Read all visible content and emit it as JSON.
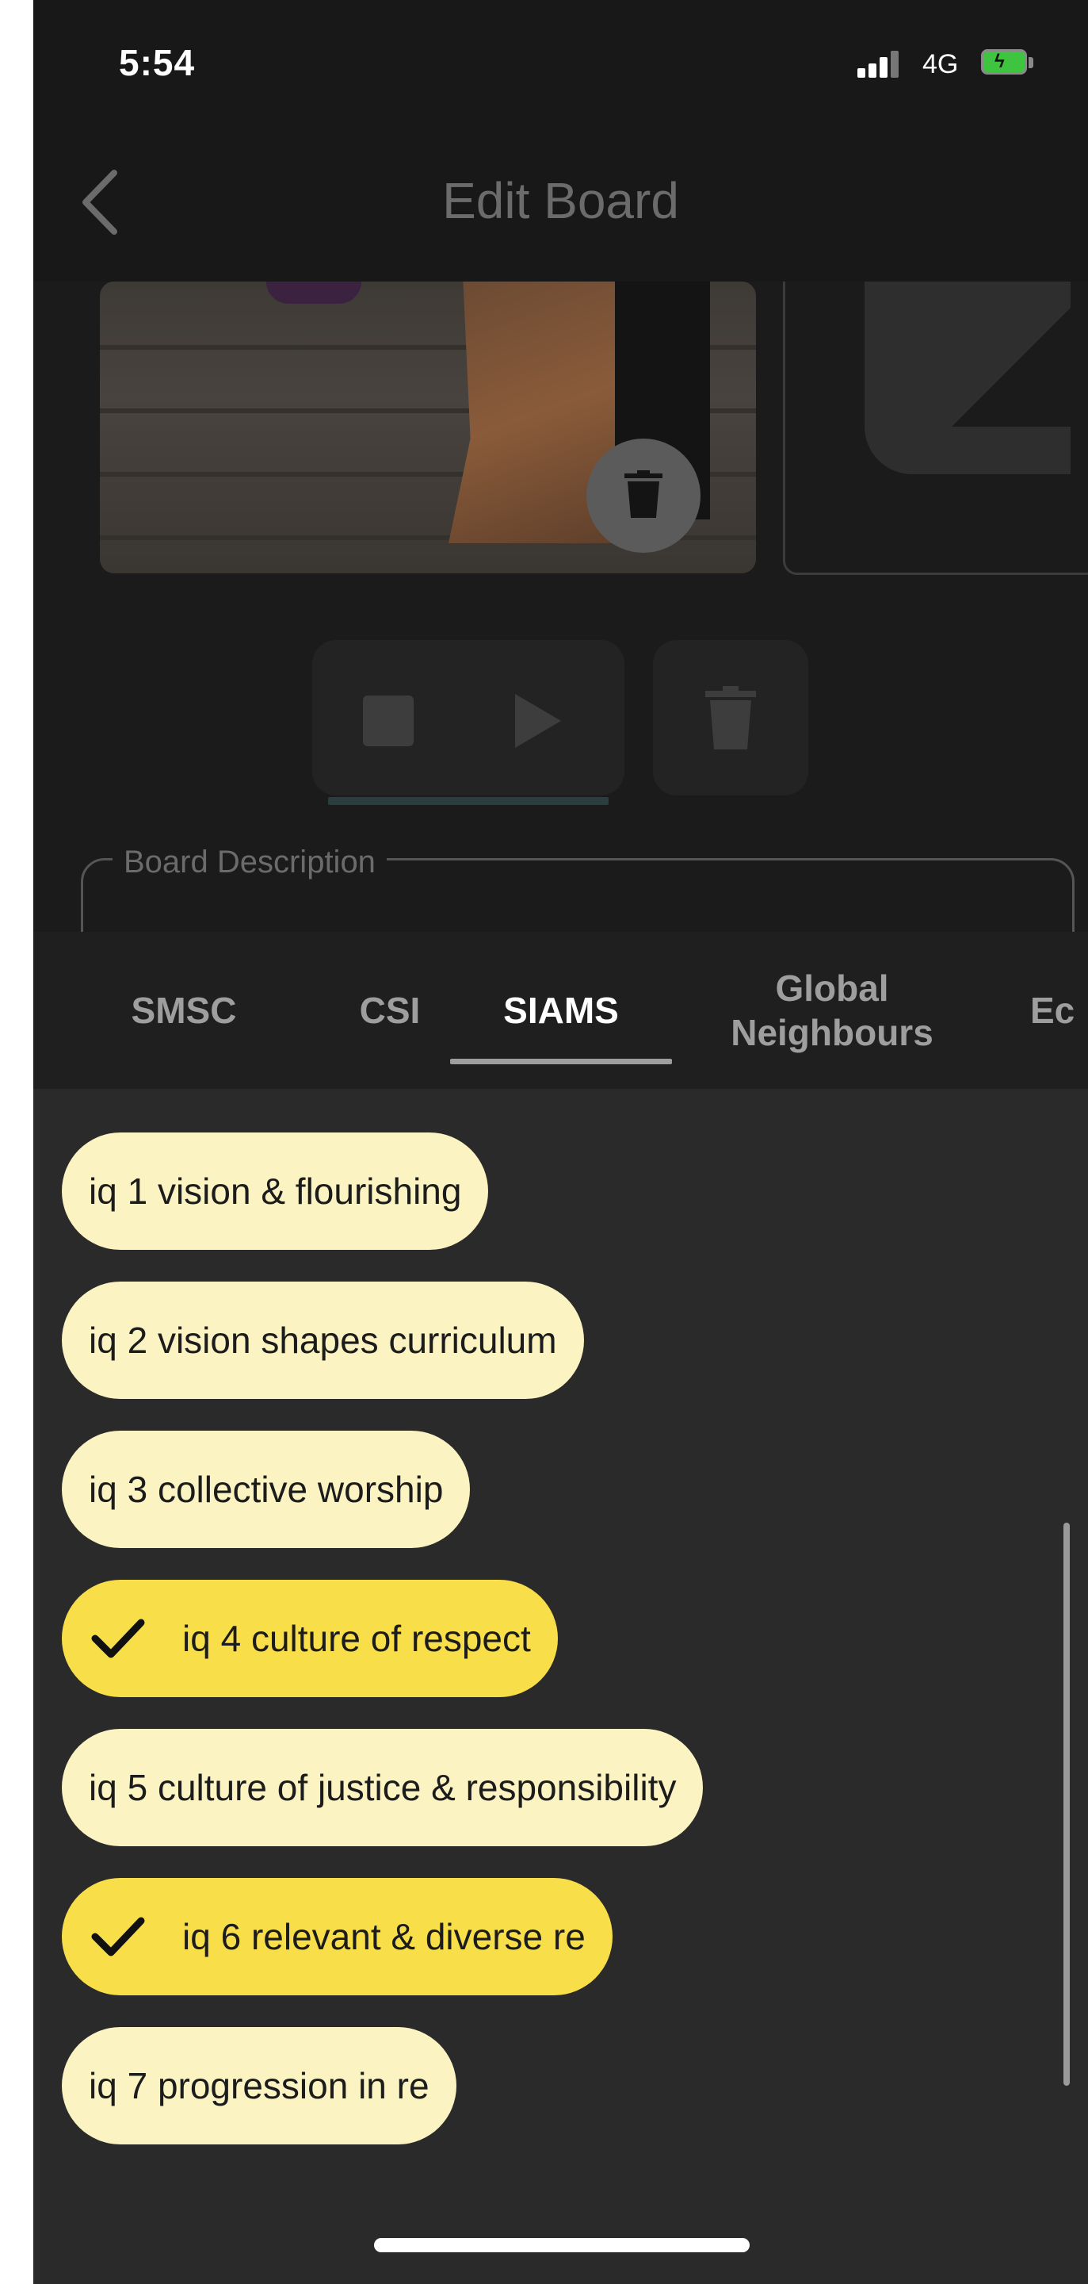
{
  "status_bar": {
    "time": "5:54",
    "network": "4G",
    "battery_color": "#3ec43e"
  },
  "nav": {
    "title": "Edit Board",
    "back_icon": "chevron-left-icon"
  },
  "description": {
    "label": "Board Description"
  },
  "tabs": [
    {
      "label": "SMSC",
      "active": false
    },
    {
      "label": "CSI",
      "active": false
    },
    {
      "label": "SIAMS",
      "active": true
    },
    {
      "label": "Global\nNeighbours",
      "active": false
    },
    {
      "label": "Ec",
      "active": false
    }
  ],
  "chips": [
    {
      "label": "iq 1 vision & flourishing",
      "selected": false
    },
    {
      "label": "iq 2 vision shapes curriculum",
      "selected": false
    },
    {
      "label": "iq 3 collective worship",
      "selected": false
    },
    {
      "label": "iq 4 culture of respect",
      "selected": true
    },
    {
      "label": "iq 5 culture of justice & responsibility",
      "selected": false
    },
    {
      "label": "iq 6 relevant & diverse re",
      "selected": true
    },
    {
      "label": "iq 7 progression in re",
      "selected": false
    }
  ],
  "colors": {
    "chip_unselected": "#fbf3c1",
    "chip_selected": "#f8df4a",
    "background": "#2a2a2a"
  }
}
